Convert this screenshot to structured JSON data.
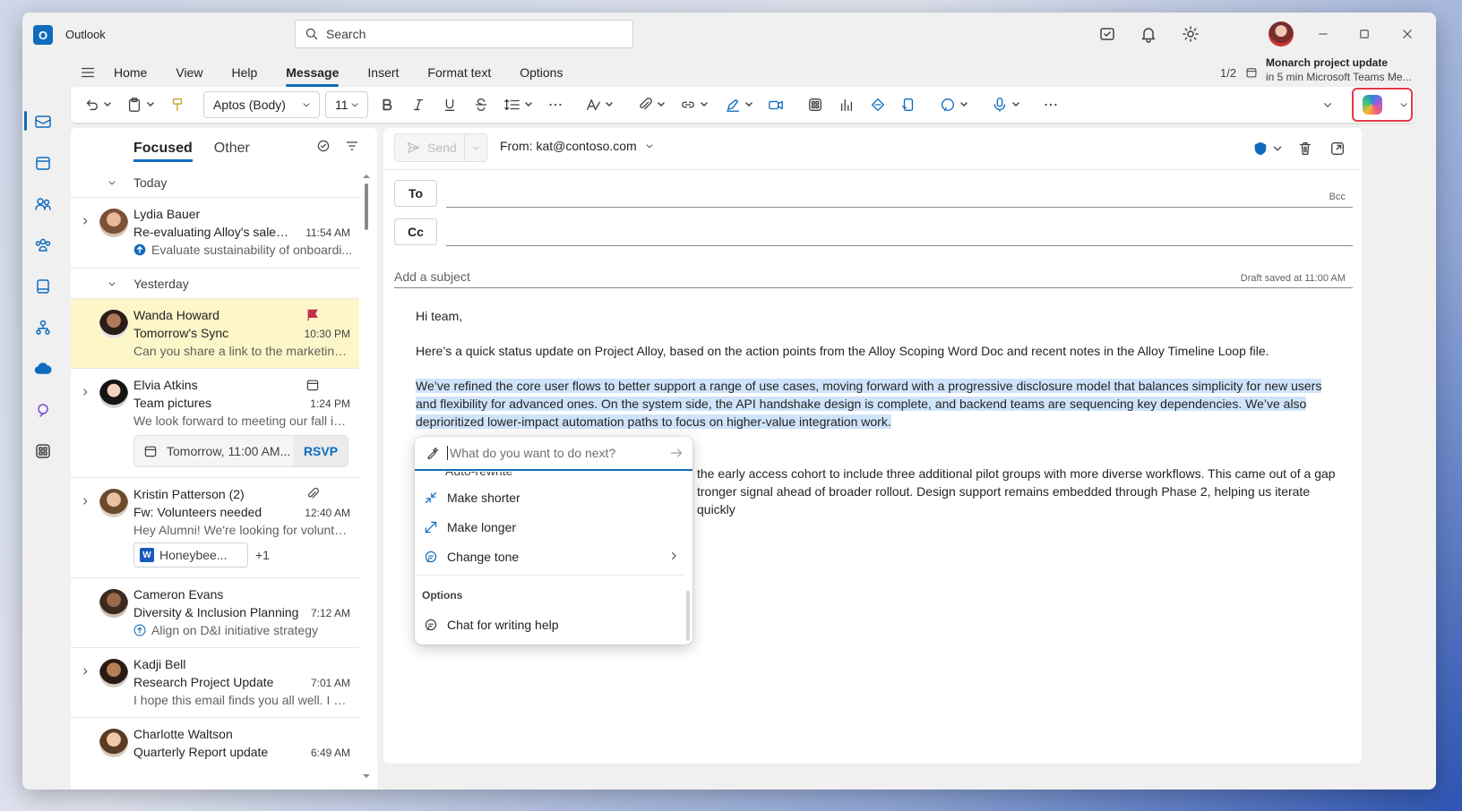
{
  "app": {
    "name": "Outlook",
    "logo_letter": "O"
  },
  "search": {
    "placeholder": "Search"
  },
  "ribbon": {
    "tabs": [
      "Home",
      "View",
      "Help",
      "Message",
      "Insert",
      "Format text",
      "Options"
    ],
    "active_tab": "Message",
    "font_family": "Aptos (Body)",
    "font_size": "11"
  },
  "upcoming": {
    "pager": "1/2",
    "title": "Monarch project update",
    "subtitle": "in 5 min Microsoft Teams Me..."
  },
  "message_list": {
    "tabs": [
      "Focused",
      "Other"
    ],
    "groups": [
      "Today",
      "Yesterday"
    ],
    "items": [
      {
        "sender": "Lydia Bauer",
        "subject": "Re-evaluating Alloy's sales b...",
        "time": "11:54 AM",
        "preview": "Evaluate sustainability of onboardi..."
      },
      {
        "sender": "Wanda Howard",
        "subject": "Tomorrow's Sync",
        "time": "10:30 PM",
        "preview": "Can you share a link to the marketing..."
      },
      {
        "sender": "Elvia Atkins",
        "subject": "Team pictures",
        "time": "1:24 PM",
        "preview": "We look forward to meeting our fall in...",
        "event": "Tomorrow, 11:00 AM...",
        "rsvp": "RSVP"
      },
      {
        "sender": "Kristin Patterson (2)",
        "subject": "Fw: Volunteers needed",
        "time": "12:40 AM",
        "preview": "Hey Alumni! We're looking for volunte...",
        "attachment": "Honeybee...",
        "more": "+1"
      },
      {
        "sender": "Cameron Evans",
        "subject": "Diversity & Inclusion Planning",
        "time": "7:12 AM",
        "preview": "Align on D&I initiative strategy"
      },
      {
        "sender": "Kadji Bell",
        "subject": "Research Project Update",
        "time": "7:01 AM",
        "preview": "I hope this email finds you all well. I w..."
      },
      {
        "sender": "Charlotte Waltson",
        "subject": "Quarterly Report update",
        "time": "6:49 AM"
      }
    ]
  },
  "compose": {
    "send_label": "Send",
    "from": "From: kat@contoso.com",
    "to_label": "To",
    "cc_label": "Cc",
    "bcc_label": "Bcc",
    "subject_placeholder": "Add a subject",
    "draft_status": "Draft saved at 11:00 AM",
    "greeting": "Hi team,",
    "para1": "Here’s a quick status update on Project Alloy, based on the action points from the Alloy Scoping Word Doc and recent notes in the Alloy Timeline Loop file.",
    "para2": "We’ve refined the core user flows to better support a range of use cases, moving forward with a progressive disclosure model that balances simplicity for new users and flexibility for advanced ones. On the system side, the API handshake design is complete, and backend teams are sequencing key dependencies. We’ve also deprioritized lower-impact automation paths to focus on higher-value integration work.",
    "para3_line1": "the early access cohort to include three additional pilot groups with more diverse workflows. This came out of a gap",
    "para3_line2": "tronger signal ahead of broader rollout. Design support remains embedded through Phase 2, helping us iterate quickly"
  },
  "copilot": {
    "prompt_placeholder": "What do you want to do next?",
    "peek_item": "Auto-rewrite",
    "items": [
      "Make shorter",
      "Make longer",
      "Change tone"
    ],
    "options_label": "Options",
    "chat_item": "Chat for writing help"
  },
  "colors": {
    "accent": "#0f6cbd",
    "selected_row": "#fdf6c9",
    "highlight": "#cfe4fa",
    "flag": "#c4314b"
  }
}
